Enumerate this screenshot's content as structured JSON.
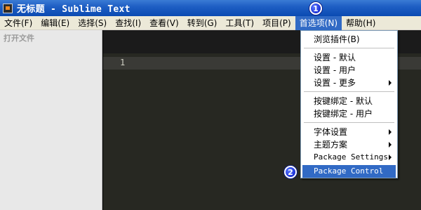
{
  "window": {
    "title": "无标题 - Sublime Text"
  },
  "badges": [
    "1",
    "2"
  ],
  "menubar": [
    "文件(F)",
    "编辑(E)",
    "选择(S)",
    "查找(I)",
    "查看(V)",
    "转到(G)",
    "工具(T)",
    "项目(P)",
    "首选项(N)",
    "帮助(H)"
  ],
  "sidebar": {
    "title": "打开文件"
  },
  "editor": {
    "line_number": "1"
  },
  "dropdown": {
    "items": [
      "浏览插件(B)",
      "设置 - 默认",
      "设置 - 用户",
      "设置 - 更多",
      "按键绑定 - 默认",
      "按键绑定 - 用户",
      "字体设置",
      "主题方案",
      "Package Settings",
      "Package Control"
    ],
    "selected": "Package Control"
  },
  "colors": {
    "title_bar": "#0a4ab2",
    "menu_highlight": "#316ac5",
    "editor_bg": "#272822",
    "sidebar_bg": "#e8e8e8"
  }
}
